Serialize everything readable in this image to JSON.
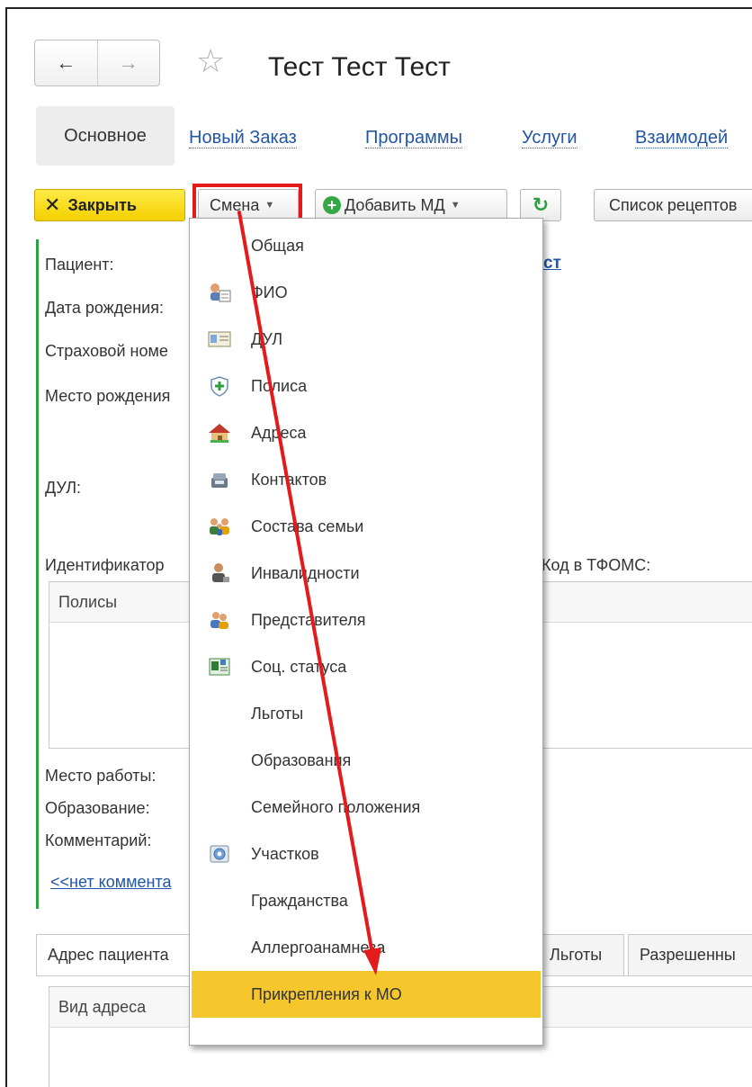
{
  "nav": {
    "back_symbol": "←",
    "forward_symbol": "→"
  },
  "window": {
    "title": "Тест Тест Тест"
  },
  "tabs": [
    {
      "label": "Основное"
    },
    {
      "label": "Новый Заказ"
    },
    {
      "label": "Программы"
    },
    {
      "label": "Услуги"
    },
    {
      "label": "Взаимодей"
    }
  ],
  "toolbar": {
    "close_label": "Закрыть",
    "shift_label": "Смена",
    "add_md_label": "Добавить МД",
    "recipes_label": "Список рецептов"
  },
  "form": {
    "labels": {
      "patient": "Пациент:",
      "birth_date": "Дата рождения:",
      "insurance": "Страховой номе",
      "birth_place": "Место рождения",
      "dul": "ДУЛ:",
      "identifier": "Идентификатор",
      "tfoms_code": "Код в ТФОМС:",
      "work_place": "Место работы:",
      "education": "Образование:",
      "comment": "Комментарий:"
    },
    "patient_link_fragment": "ст",
    "policies_header": "Полисы",
    "comment_link": "<<нет коммента"
  },
  "bottom": {
    "tabs": [
      {
        "label": "Адрес пациента"
      },
      {
        "label": "Льготы"
      },
      {
        "label": "Разрешенны"
      }
    ],
    "table_header": "Вид адреса"
  },
  "menu": {
    "items": [
      {
        "label": "Общая",
        "icon": ""
      },
      {
        "label": "ФИО",
        "icon": "person-card-icon"
      },
      {
        "label": "ДУЛ",
        "icon": "id-card-icon"
      },
      {
        "label": "Полиса",
        "icon": "shield-icon"
      },
      {
        "label": "Адреса",
        "icon": "house-icon"
      },
      {
        "label": "Контактов",
        "icon": "phone-icon"
      },
      {
        "label": "Состава семьи",
        "icon": "family-icon"
      },
      {
        "label": "Инвалидности",
        "icon": "disabled-person-icon"
      },
      {
        "label": "Представителя",
        "icon": "representative-icon"
      },
      {
        "label": "Соц. статуса",
        "icon": "social-status-icon"
      },
      {
        "label": "Льготы",
        "icon": ""
      },
      {
        "label": "Образования",
        "icon": ""
      },
      {
        "label": "Семейного положения",
        "icon": ""
      },
      {
        "label": "Участков",
        "icon": "area-icon"
      },
      {
        "label": "Гражданства",
        "icon": ""
      },
      {
        "label": "Аллергоанамнеза",
        "icon": ""
      },
      {
        "label": "Прикрепления к МО",
        "icon": "",
        "selected": true
      }
    ]
  },
  "colors": {
    "accent_link": "#2255a4",
    "highlight_red": "#e31b1b",
    "selection": "#f6c72c",
    "close_button": "#f4d000",
    "green_bar": "#2ea043"
  }
}
